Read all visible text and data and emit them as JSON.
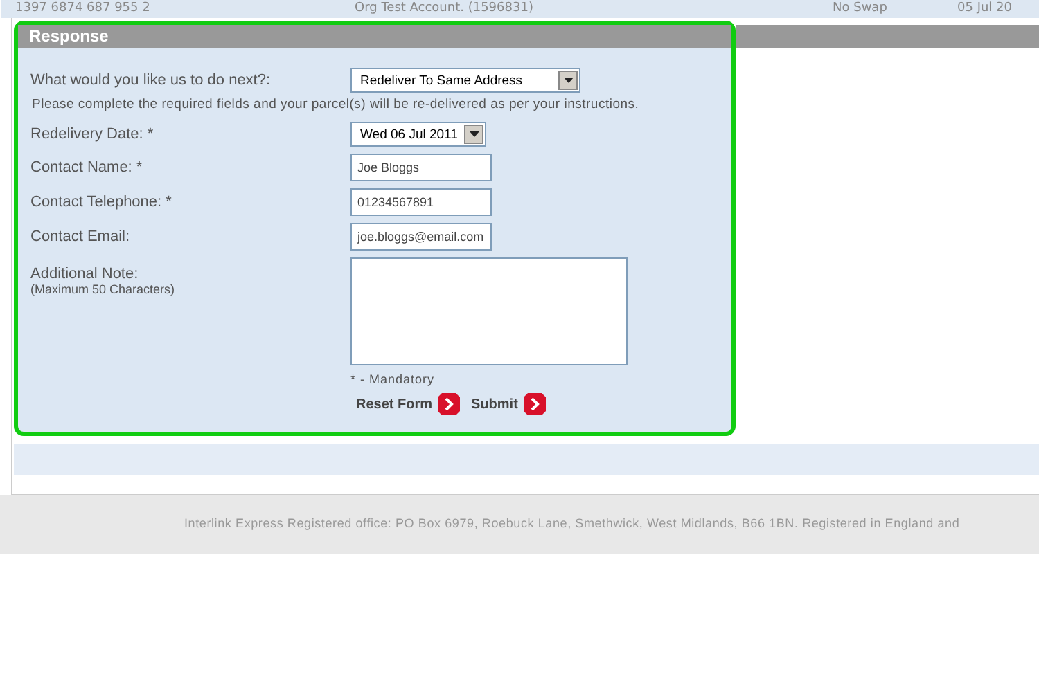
{
  "previous_row": {
    "cells": [
      "1397 6874 687 955 2",
      "Org Test Account. (1596831)",
      "No Swap",
      "05 Jul 20"
    ]
  },
  "response": {
    "title": "Response",
    "next_action": {
      "label": "What would you like us to do next?:",
      "value": "Redeliver To Same Address"
    },
    "instructions": "Please complete the required fields and your parcel(s) will be re-delivered as per your instructions.",
    "fields": [
      {
        "kind": "select",
        "label": "Redelivery Date: *",
        "value": "Wed 06 Jul 2011"
      },
      {
        "kind": "text",
        "label": "Contact Name: *",
        "value": "Joe Bloggs"
      },
      {
        "kind": "text",
        "label": "Contact Telephone: *",
        "value": "01234567891"
      },
      {
        "kind": "text",
        "label": "Contact Email:",
        "value": "joe.bloggs@email.com"
      },
      {
        "kind": "textarea",
        "label": "Additional Note:",
        "hint": "(Maximum 50 Characters)"
      }
    ],
    "mandatory_note": "* - Mandatory",
    "buttons": [
      "Reset Form",
      "Submit"
    ]
  },
  "footer": "Interlink Express Registered office: PO Box 6979, Roebuck Lane, Smethwick, West Midlands, B66 1BN. Registered in England and"
}
